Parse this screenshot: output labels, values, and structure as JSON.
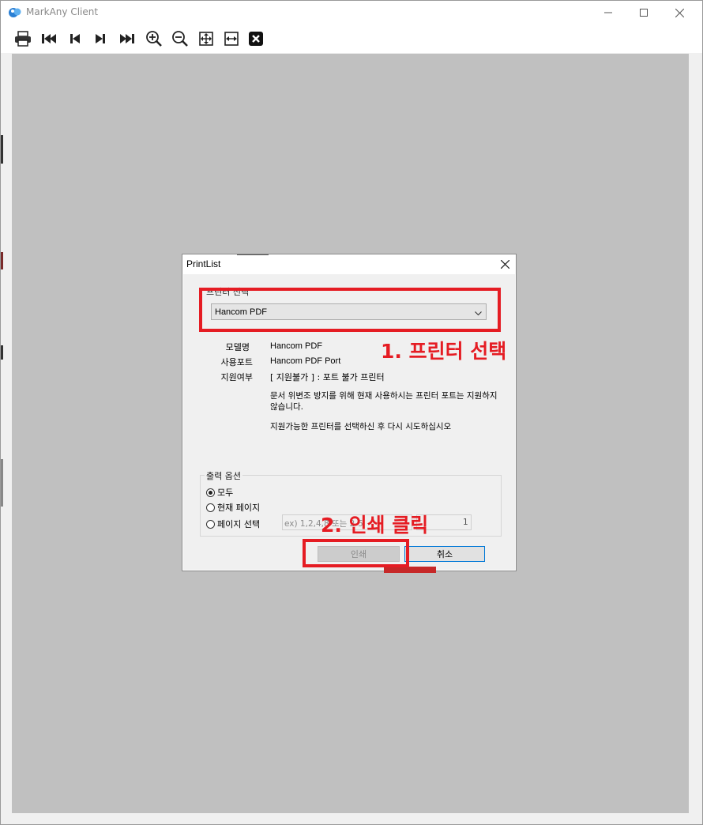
{
  "window": {
    "title": "MarkAny Client"
  },
  "toolbar": {
    "buttons": [
      "printer-icon",
      "first-page-icon",
      "prev-page-icon",
      "next-page-icon",
      "last-page-icon",
      "zoom-in-icon",
      "zoom-out-icon",
      "fit-page-icon",
      "fit-width-icon",
      "close-doc-icon"
    ]
  },
  "dialog": {
    "title": "PrintList",
    "printer_group_label": "프린터 선택",
    "printer_select": {
      "value": "Hancom PDF"
    },
    "info": {
      "model_label": "모델명",
      "model_value": "Hancom PDF",
      "port_label": "사용포트",
      "port_value": "Hancom PDF Port",
      "support_label": "지원여부",
      "support_value": "[ 지원불가 ] : 포트 불가 프린터"
    },
    "message1": "문서 위변조 방지를 위해 현재 사용하시는 프린터 포트는 지원하지 않습니다.",
    "message2": "지원가능한 프린터를 선택하신 후 다시 시도하십시오",
    "output_group_label": "출력 옵션",
    "options": {
      "all": "모두",
      "current": "현재 페이지",
      "select": "페이지 선택"
    },
    "page_input_placeholder": "ex) 1,2,4,8 또는 2-5",
    "page_count": "1",
    "print_button": "인쇄",
    "cancel_button": "취소"
  },
  "annotations": {
    "step1": "1. 프린터 선택",
    "step2": "2. 인쇄 클릭"
  },
  "colors": {
    "annotation_red": "#e51c23",
    "viewer_gray": "#c0c0c0",
    "focus_blue": "#0078d7"
  }
}
